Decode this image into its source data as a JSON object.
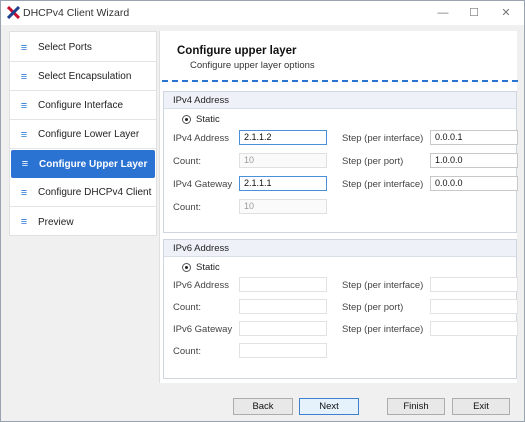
{
  "window": {
    "title": "DHCPv4 Client Wizard",
    "controls": {
      "minimize": "—",
      "maximize": "☐",
      "close": "✕"
    }
  },
  "sidebar": {
    "items": [
      {
        "label": "Select Ports",
        "active": false
      },
      {
        "label": "Select Encapsulation",
        "active": false
      },
      {
        "label": "Configure Interface",
        "active": false
      },
      {
        "label": "Configure Lower Layer",
        "active": false
      },
      {
        "label": "Configure Upper Layer",
        "active": true
      },
      {
        "label": "Configure DHCPv4 Client",
        "active": false
      },
      {
        "label": "Preview",
        "active": false
      }
    ],
    "item_icon": "≡"
  },
  "page": {
    "title": "Configure upper layer",
    "subtitle": "Configure upper layer options"
  },
  "ipv4": {
    "header": "IPv4 Address",
    "mode": "Static",
    "address_label": "IPv4 Address",
    "address_value": "2.1.1.2",
    "count1_label": "Count:",
    "count1_value": "10",
    "gateway_label": "IPv4 Gateway",
    "gateway_value": "2.1.1.1",
    "count2_label": "Count:",
    "count2_value": "10",
    "step1_label": "Step (per interface)",
    "step1_value": "0.0.0.1",
    "step2_label": "Step (per port)",
    "step2_value": "1.0.0.0",
    "step3_label": "Step (per interface)",
    "step3_value": "0.0.0.0"
  },
  "ipv6": {
    "header": "IPv6 Address",
    "mode": "Static",
    "address_label": "IPv6 Address",
    "address_value": "",
    "count1_label": "Count:",
    "count1_value": "",
    "gateway_label": "IPv6 Gateway",
    "gateway_value": "",
    "count2_label": "Count:",
    "count2_value": "",
    "step1_label": "Step (per interface)",
    "step1_value": "",
    "step2_label": "Step (per port)",
    "step2_value": "",
    "step3_label": "Step (per interface)",
    "step3_value": ""
  },
  "buttons": {
    "back": "Back",
    "next": "Next",
    "finish": "Finish",
    "exit": "Exit"
  },
  "colors": {
    "accent": "#2b73d3",
    "app_icon_red": "#c8102e",
    "app_icon_blue": "#1f3f8f"
  }
}
